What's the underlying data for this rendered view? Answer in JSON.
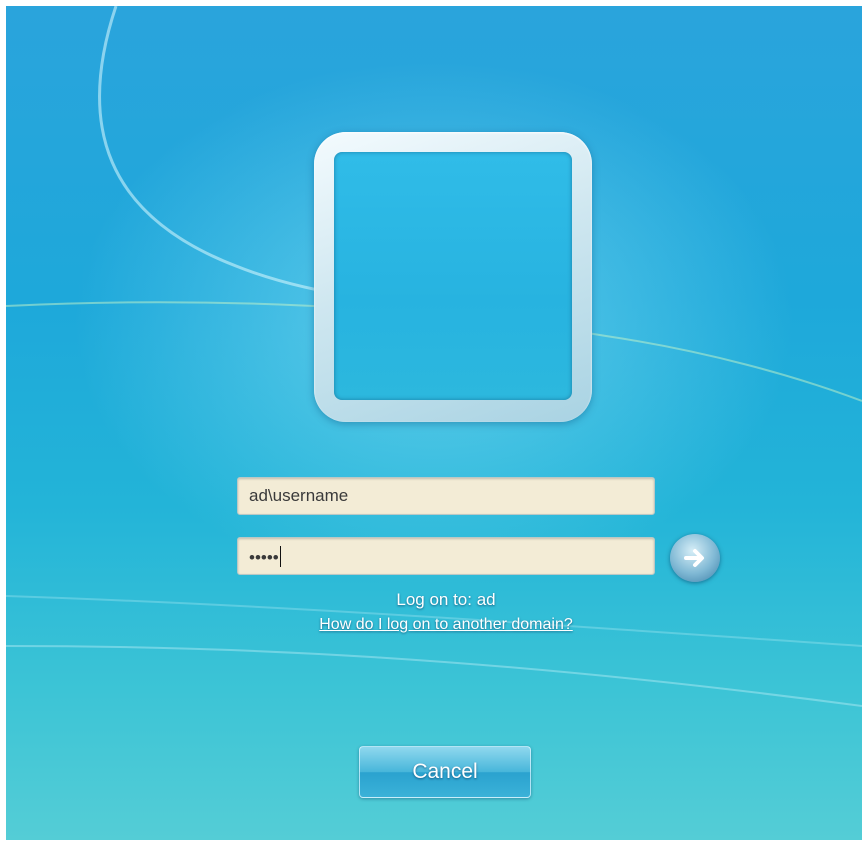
{
  "login": {
    "username_value": "ad\\username",
    "password_mask": "•••••",
    "logon_to": "Log on to: ad",
    "other_domain_link": "How do I log on to another domain?"
  },
  "actions": {
    "cancel_label": "Cancel"
  },
  "icons": {
    "submit": "arrow-right-icon",
    "user_tile": "user-picture-frame"
  },
  "colors": {
    "background": "#1ea8da",
    "field_background": "#f3ecd6",
    "text_light": "#ffffff"
  }
}
